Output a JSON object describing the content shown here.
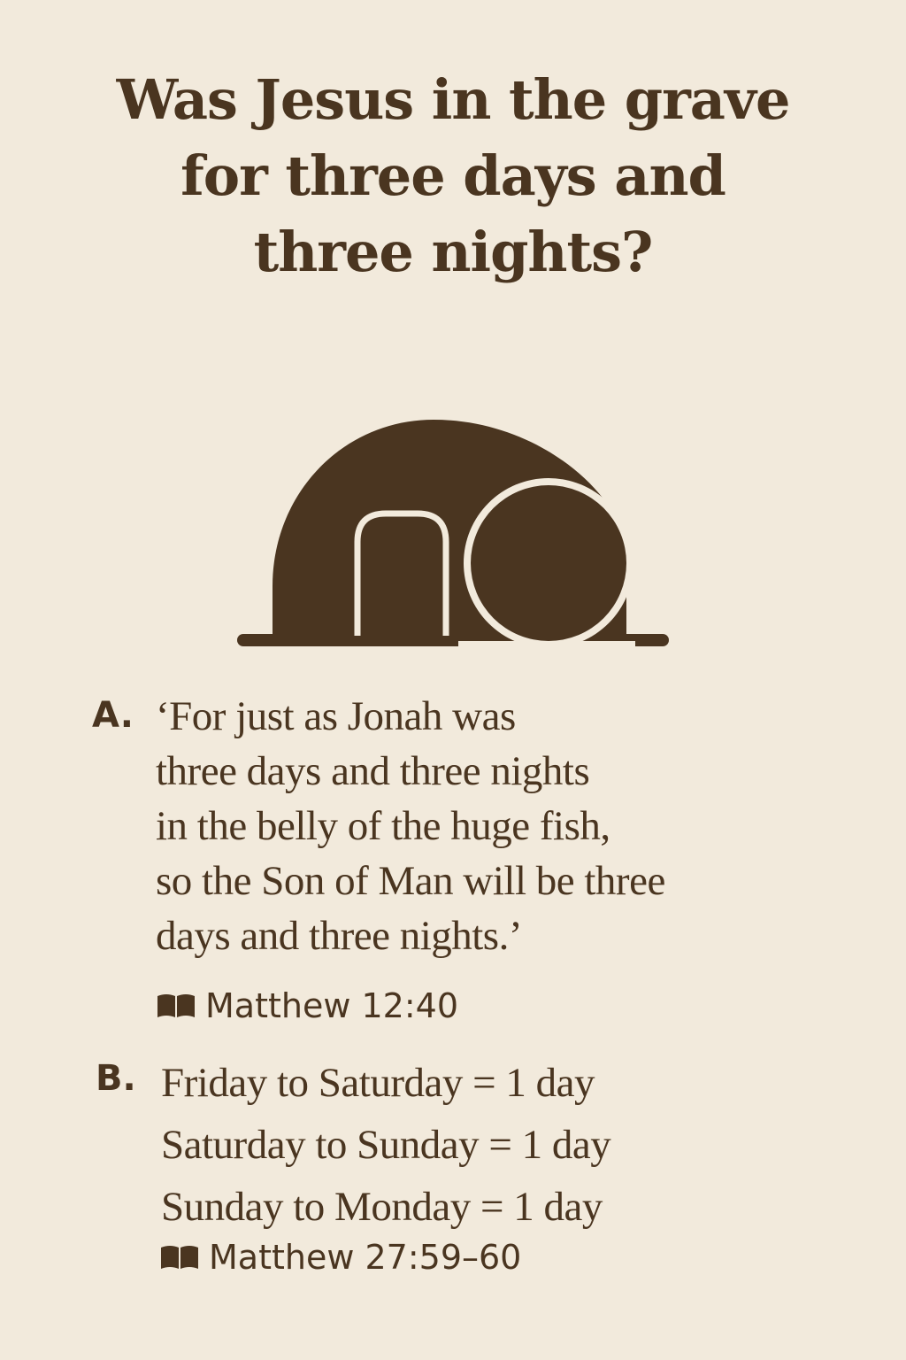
{
  "title": {
    "lines": [
      "Was Jesus in the grave",
      "for three days and",
      "three nights?"
    ]
  },
  "items": [
    {
      "letter": "A.",
      "lines": [
        "‘For just as Jonah was",
        "three days and three nights",
        "in the belly of the huge fish,",
        "so the Son of Man will be three",
        "days and three nights.’"
      ],
      "reference": "Matthew 12:40"
    },
    {
      "letter": "B.",
      "lines": [
        "Friday to Saturday = 1 day",
        "Saturday to Sunday = 1 day",
        "Sunday to Monday = 1 day"
      ],
      "reference": "Matthew 27:59–60"
    }
  ],
  "icons": {
    "tomb": "tomb-icon",
    "book": "book-icon"
  },
  "colors": {
    "background": "#f2eadc",
    "ink": "#4a3520"
  }
}
